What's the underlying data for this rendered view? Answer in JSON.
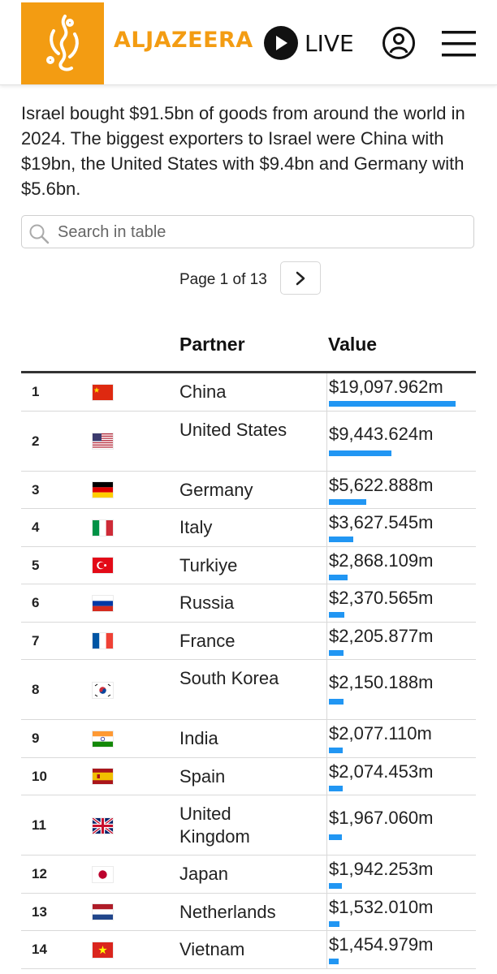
{
  "header": {
    "brand": "ALJAZEERA",
    "live_label": "LIVE",
    "logo_icon": "al-jazeera-logo",
    "accent_color": "#f39c12"
  },
  "intro": "Israel bought $91.5bn of goods from around the world in 2024. The biggest exporters to Israel were China with $19bn, the United States with $9.4bn and Germany with $5.6bn.",
  "search": {
    "placeholder": "Search in table"
  },
  "pagination": {
    "label": "Page 1 of 13"
  },
  "table": {
    "headers": {
      "partner": "Partner",
      "value": "Value"
    },
    "bar_color": "#2196f3",
    "rows": [
      {
        "rank": "1",
        "partner": "China",
        "value": "$19,097.962m",
        "amount": 19097.962,
        "flag": "cn"
      },
      {
        "rank": "2",
        "partner": "United States",
        "value": "$9,443.624m",
        "amount": 9443.624,
        "flag": "us"
      },
      {
        "rank": "3",
        "partner": "Germany",
        "value": "$5,622.888m",
        "amount": 5622.888,
        "flag": "de"
      },
      {
        "rank": "4",
        "partner": "Italy",
        "value": "$3,627.545m",
        "amount": 3627.545,
        "flag": "it"
      },
      {
        "rank": "5",
        "partner": "Turkiye",
        "value": "$2,868.109m",
        "amount": 2868.109,
        "flag": "tr"
      },
      {
        "rank": "6",
        "partner": "Russia",
        "value": "$2,370.565m",
        "amount": 2370.565,
        "flag": "ru"
      },
      {
        "rank": "7",
        "partner": "France",
        "value": "$2,205.877m",
        "amount": 2205.877,
        "flag": "fr"
      },
      {
        "rank": "8",
        "partner": "South Korea",
        "value": "$2,150.188m",
        "amount": 2150.188,
        "flag": "kr"
      },
      {
        "rank": "9",
        "partner": "India",
        "value": "$2,077.110m",
        "amount": 2077.11,
        "flag": "in"
      },
      {
        "rank": "10",
        "partner": "Spain",
        "value": "$2,074.453m",
        "amount": 2074.453,
        "flag": "es"
      },
      {
        "rank": "11",
        "partner": "United Kingdom",
        "value": "$1,967.060m",
        "amount": 1967.06,
        "flag": "gb"
      },
      {
        "rank": "12",
        "partner": "Japan",
        "value": "$1,942.253m",
        "amount": 1942.253,
        "flag": "jp"
      },
      {
        "rank": "13",
        "partner": "Netherlands",
        "value": "$1,532.010m",
        "amount": 1532.01,
        "flag": "nl"
      },
      {
        "rank": "14",
        "partner": "Vietnam",
        "value": "$1,454.979m",
        "amount": 1454.979,
        "flag": "vn"
      }
    ]
  }
}
